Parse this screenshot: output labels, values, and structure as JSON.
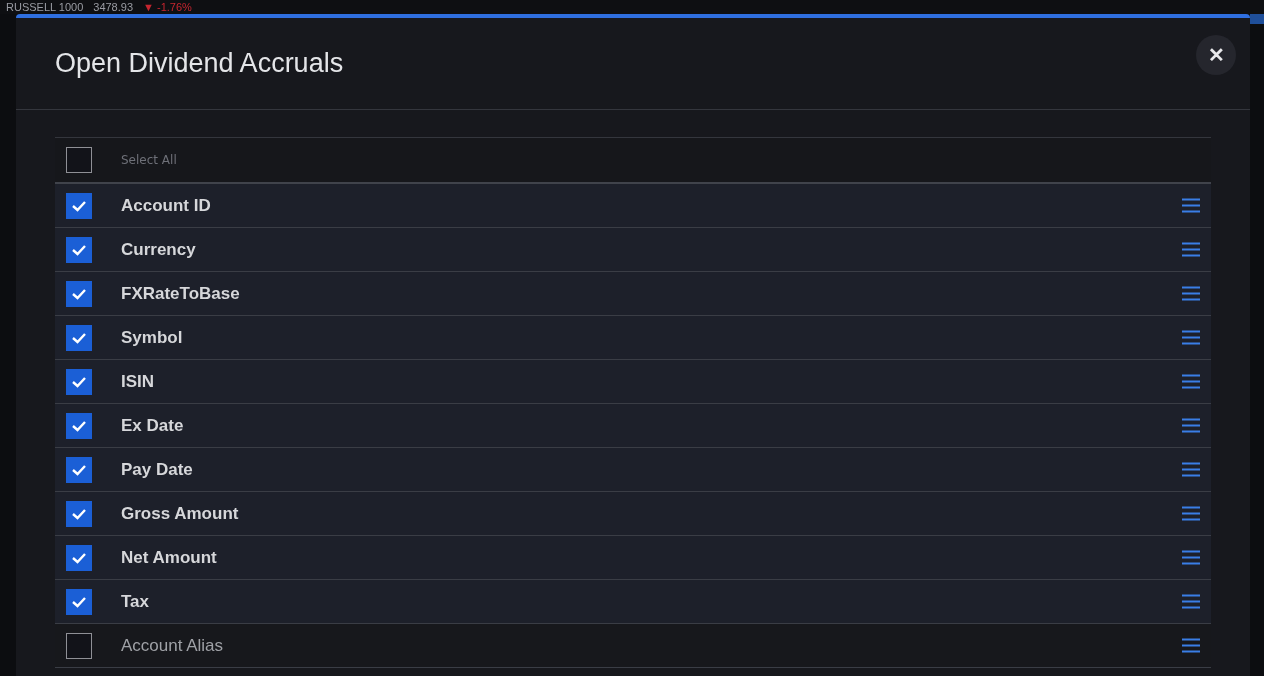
{
  "ticker": {
    "index": "RUSSELL 1000",
    "value": "3478.93",
    "change": "▼ -1.76%"
  },
  "dialog": {
    "title": "Open Dividend Accruals",
    "close": "✕"
  },
  "select_all": {
    "label": "Select All",
    "checked": false
  },
  "columns": [
    {
      "label": "Account ID",
      "checked": true
    },
    {
      "label": "Currency",
      "checked": true
    },
    {
      "label": "FXRateToBase",
      "checked": true
    },
    {
      "label": "Symbol",
      "checked": true
    },
    {
      "label": "ISIN",
      "checked": true
    },
    {
      "label": "Ex Date",
      "checked": true
    },
    {
      "label": "Pay Date",
      "checked": true
    },
    {
      "label": "Gross Amount",
      "checked": true
    },
    {
      "label": "Net Amount",
      "checked": true
    },
    {
      "label": "Tax",
      "checked": true
    },
    {
      "label": "Account Alias",
      "checked": false
    }
  ]
}
